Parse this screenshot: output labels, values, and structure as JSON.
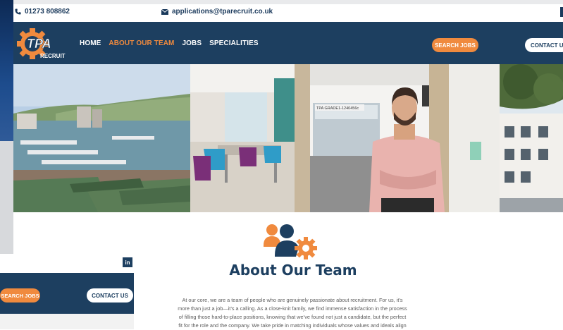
{
  "topbar": {
    "phone": "01273 808862",
    "phone_icon": "phone-icon",
    "email": "applications@tparecruit.co.uk",
    "email_icon": "envelope-icon"
  },
  "nav": {
    "logo_text": "TPA",
    "logo_sub": "RECRUIT",
    "items": [
      {
        "label": "HOME",
        "active": false
      },
      {
        "label": "ABOUT OUR TEAM",
        "active": true
      },
      {
        "label": "JOBS",
        "active": false
      },
      {
        "label": "SPECIALITIES",
        "active": false
      }
    ],
    "search_button": "SEARCH JOBS",
    "contact_button": "CONTACT US"
  },
  "photos": {
    "sign_text": "TPA GRADE1-1240456c"
  },
  "main": {
    "icon": "team-gear-icon",
    "title": "About Our Team",
    "paragraph_lines": [
      "At our core, we are a team of people who are genuinely passionate about recruitment. For us, it’s",
      "more than just a job—it’s a calling. As a close-knit family, we find immense satisfaction in the process",
      "of filling those hard-to-place positions, knowing that we’ve found not just a candidate, but the perfect",
      "fit for the role and the company. We take pride in matching individuals whose values and ideals align"
    ]
  },
  "overlay": {
    "linkedin_label": "in",
    "search_button": "SEARCH JOBS",
    "contact_button": "CONTACT US"
  },
  "colors": {
    "navy": "#1d3f60",
    "orange": "#f08a3e",
    "white": "#ffffff"
  }
}
